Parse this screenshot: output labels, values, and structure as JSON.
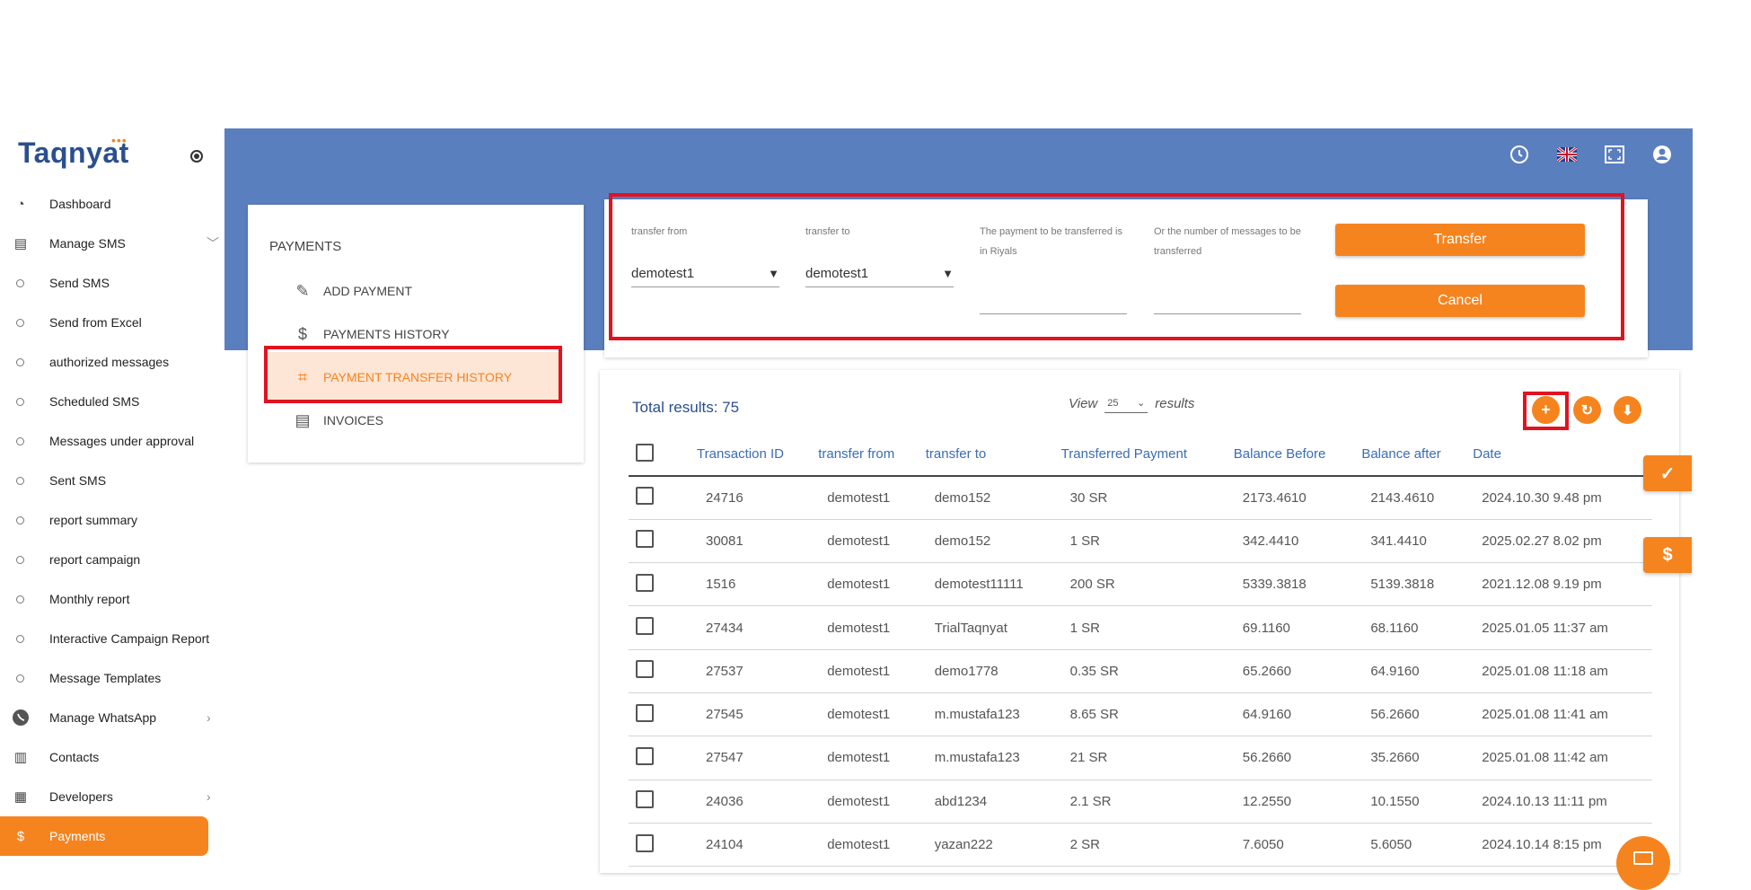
{
  "brand": {
    "name": "Taqnyat",
    "dots": "•••"
  },
  "header_icons": [
    "clock-icon",
    "uk-flag-icon",
    "fullscreen-icon",
    "account-icon"
  ],
  "sidebar": {
    "items": [
      {
        "label": "Dashboard",
        "icon": "dashboard-icon"
      },
      {
        "label": "Manage SMS",
        "icon": "sms-icon",
        "chevron": "﹀"
      },
      {
        "label": "Send SMS",
        "sub": true
      },
      {
        "label": "Send from Excel",
        "sub": true
      },
      {
        "label": "authorized messages",
        "sub": true
      },
      {
        "label": "Scheduled SMS",
        "sub": true
      },
      {
        "label": "Messages under approval",
        "sub": true
      },
      {
        "label": "Sent SMS",
        "sub": true
      },
      {
        "label": "report summary",
        "sub": true
      },
      {
        "label": "report campaign",
        "sub": true
      },
      {
        "label": "Monthly report",
        "sub": true
      },
      {
        "label": "Interactive Campaign Report",
        "sub": true
      },
      {
        "label": "Message Templates",
        "sub": true
      },
      {
        "label": "Manage WhatsApp",
        "icon": "whatsapp-icon",
        "chevron": "›"
      },
      {
        "label": "Contacts",
        "icon": "contacts-icon"
      },
      {
        "label": "Developers",
        "icon": "developers-icon",
        "chevron": "›"
      },
      {
        "label": "Payments",
        "icon": "dollar-icon",
        "active": true
      }
    ]
  },
  "payments_menu": {
    "title": "PAYMENTS",
    "add": "ADD PAYMENT",
    "history": "PAYMENTS HISTORY",
    "transfer_history": "PAYMENT TRANSFER HISTORY",
    "invoices": "INVOICES"
  },
  "transfer_form": {
    "from_label": "transfer from",
    "from_value": "demotest1",
    "to_label": "transfer to",
    "to_value": "demotest1",
    "riyals_label": "The payment to be transferred is in Riyals",
    "messages_label": "Or the number of messages to be transferred",
    "transfer_button": "Transfer",
    "cancel_button": "Cancel",
    "caret": "▼"
  },
  "results": {
    "total": "Total results: 75",
    "view_label": "View",
    "view_value": "25",
    "results_label": "results"
  },
  "table": {
    "columns": [
      "Transaction ID",
      "transfer from",
      "transfer to",
      "Transferred Payment",
      "Balance Before",
      "Balance after",
      "Date"
    ],
    "rows": [
      [
        "24716",
        "demotest1",
        "demo152",
        "30 SR",
        "2173.4610",
        "2143.4610",
        "2024.10.30 9.48 pm"
      ],
      [
        "30081",
        "demotest1",
        "demo152",
        "1 SR",
        "342.4410",
        "341.4410",
        "2025.02.27 8.02 pm"
      ],
      [
        "1516",
        "demotest1",
        "demotest11111",
        "200 SR",
        "5339.3818",
        "5139.3818",
        "2021.12.08 9.19 pm"
      ],
      [
        "27434",
        "demotest1",
        "TrialTaqnyat",
        "1 SR",
        "69.1160",
        "68.1160",
        "2025.01.05 11:37 am"
      ],
      [
        "27537",
        "demotest1",
        "demo1778",
        "0.35 SR",
        "65.2660",
        "64.9160",
        "2025.01.08 11:18 am"
      ],
      [
        "27545",
        "demotest1",
        "m.mustafa123",
        "8.65 SR",
        "64.9160",
        "56.2660",
        "2025.01.08 11:41 am"
      ],
      [
        "27547",
        "demotest1",
        "m.mustafa123",
        "21 SR",
        "56.2660",
        "35.2660",
        "2025.01.08 11:42 am"
      ],
      [
        "24036",
        "demotest1",
        "abd1234",
        "2.1 SR",
        "12.2550",
        "10.1550",
        "2024.10.13 11:11 pm"
      ],
      [
        "24104",
        "demotest1",
        "yazan222",
        "2 SR",
        "7.6050",
        "5.6050",
        "2024.10.14 8:15 pm"
      ]
    ]
  },
  "colors": {
    "accent": "#f5841f",
    "header": "#5a7fbe",
    "highlight": "#e0131f",
    "link": "#3a6db5"
  }
}
